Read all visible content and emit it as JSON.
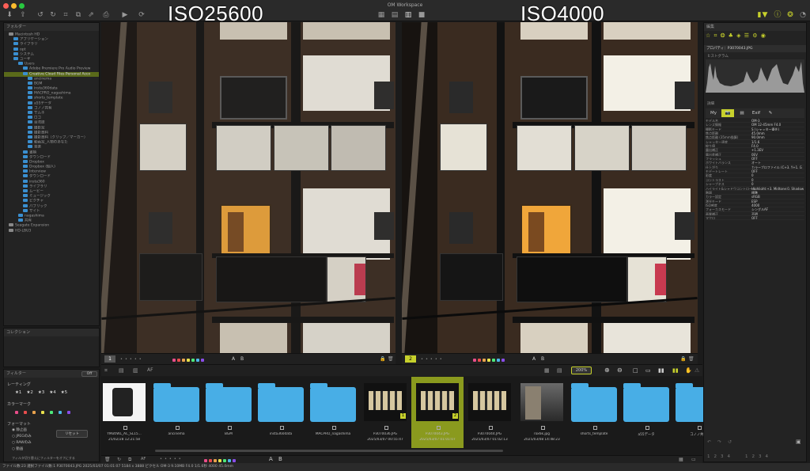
{
  "window": {
    "title": "OM Workspace"
  },
  "overlays": {
    "left": "ISO25600",
    "right": "ISO4000"
  },
  "folder_panel": {
    "title": "フォルダー",
    "tree": [
      {
        "label": "Macintosh HD",
        "indent": 1
      },
      {
        "label": "アプリケーション",
        "indent": 2
      },
      {
        "label": "ライブラリ",
        "indent": 2
      },
      {
        "label": "opt",
        "indent": 2
      },
      {
        "label": "システム",
        "indent": 2
      },
      {
        "label": "ユーザ",
        "indent": 2
      },
      {
        "label": "Users",
        "indent": 3
      },
      {
        "label": "Adobe Premiere Pro Audio Preview",
        "indent": 4
      },
      {
        "label": "Creative Cloud Files Personal Acco",
        "indent": 4,
        "selected": true
      },
      {
        "label": "ancinema",
        "indent": 5
      },
      {
        "label": "BGM",
        "indent": 5
      },
      {
        "label": "insta360data",
        "indent": 5
      },
      {
        "label": "MACPRO_nagashima",
        "indent": 5
      },
      {
        "label": "shorts_template",
        "indent": 5
      },
      {
        "label": "a55データ",
        "indent": 5
      },
      {
        "label": "コノノ共有",
        "indent": 5
      },
      {
        "label": "サムネ",
        "indent": 5
      },
      {
        "label": "ロゴ",
        "indent": 5
      },
      {
        "label": "台湾旅",
        "indent": 5
      },
      {
        "label": "撮影案",
        "indent": 5
      },
      {
        "label": "撮影資料",
        "indent": 5
      },
      {
        "label": "撮影資料（クリップ／マーカー）",
        "indent": 5
      },
      {
        "label": "動画案_人物のあなた",
        "indent": 5
      },
      {
        "label": "音楽",
        "indent": 5
      },
      {
        "label": "書類",
        "indent": 4
      },
      {
        "label": "ダウンロード",
        "indent": 4
      },
      {
        "label": "Dropbox",
        "indent": 4
      },
      {
        "label": "Dropbox (個人)",
        "indent": 4
      },
      {
        "label": "Interview",
        "indent": 4
      },
      {
        "label": "ダウンロード",
        "indent": 4
      },
      {
        "label": "insta360",
        "indent": 4
      },
      {
        "label": "ライブラリ",
        "indent": 4
      },
      {
        "label": "ムービー",
        "indent": 4
      },
      {
        "label": "ミュージック",
        "indent": 4
      },
      {
        "label": "ピクチャ",
        "indent": 4
      },
      {
        "label": "パブリック",
        "indent": 4
      },
      {
        "label": "サイト",
        "indent": 4
      },
      {
        "label": "nagashima",
        "indent": 3
      },
      {
        "label": "共有",
        "indent": 3
      },
      {
        "label": "Seagate Expansion",
        "indent": 1
      },
      {
        "label": "HD-LBU3",
        "indent": 1
      }
    ]
  },
  "collection_panel": {
    "title": "コレクション"
  },
  "filter_panel": {
    "title": "フィルター",
    "toggle": "Off",
    "rating_label": "レーティング",
    "stars": [
      "★1",
      "★2",
      "★3",
      "★4",
      "★5"
    ],
    "color_label": "カラーマーク",
    "format_label": "フォーマット",
    "formats": [
      "静止画",
      "JPEGのみ",
      "RAWのみ",
      "動画"
    ],
    "reset": "リセット",
    "hint": "フィルタ切り替えにフィルターをオフにする"
  },
  "viewer": {
    "left_index": "1",
    "right_index": "2",
    "zoom": "200%",
    "ab_a": "A",
    "ab_b": "B",
    "color_dots": [
      "#e84d8a",
      "#e84d4d",
      "#e8a24d",
      "#e8e04d",
      "#4de87a",
      "#4db6e8",
      "#8a4de8"
    ]
  },
  "filmstrip": {
    "ab_a": "A",
    "ab_b": "B",
    "items": [
      {
        "type": "photo",
        "name": "YMotIWL_AC_SL15...",
        "date": "25/02/28 12:21:58",
        "tone": "light"
      },
      {
        "type": "folder",
        "name": "ancinema"
      },
      {
        "type": "folder",
        "name": "BGM"
      },
      {
        "type": "folder",
        "name": "insta360data"
      },
      {
        "type": "folder",
        "name": "MACPRO_nagashima"
      },
      {
        "type": "photo",
        "name": "P3070036.JPG",
        "date": "2025/03/07 00:55:47",
        "badge": "1",
        "tone": "night"
      },
      {
        "type": "photo",
        "name": "P3070043.JPG",
        "date": "2025/03/07 01:01:07",
        "badge": "2",
        "selected": true,
        "tone": "night"
      },
      {
        "type": "photo",
        "name": "P3070044.JPG",
        "date": "2025/03/07 01:02:13",
        "tone": "night"
      },
      {
        "type": "photo",
        "name": "rox6k.jpg",
        "date": "2025/03/08 14:48:23",
        "tone": "street"
      },
      {
        "type": "folder",
        "name": "shorts_template"
      },
      {
        "type": "folder",
        "name": "a55データ"
      },
      {
        "type": "folder",
        "name": "コノノ共有"
      }
    ]
  },
  "right_panel": {
    "edit_title": "編集",
    "property_title": "プロパティ：P3070043.JPG",
    "histogram_label": "ヒストグラム",
    "detail_label": "詳細",
    "tabs": [
      "My",
      "📷",
      "▤",
      "Exif",
      "✎"
    ],
    "properties": [
      {
        "k": "モデル名",
        "v": "OM-3"
      },
      {
        "k": "レンズ情報",
        "v": "OM 12-45mm F4.0"
      },
      {
        "k": "撮影モード",
        "v": "S (シャッター優先)"
      },
      {
        "k": "焦点距離",
        "v": "45.0mm"
      },
      {
        "k": "焦点距離 (35mm換算)",
        "v": "90.0mm"
      },
      {
        "k": "シャッター速度",
        "v": "1/1.6"
      },
      {
        "k": "絞り値",
        "v": "F4.0"
      },
      {
        "k": "露出補正",
        "v": "+1.3EV"
      },
      {
        "k": "露出差補正",
        "v": "0EV"
      },
      {
        "k": "フラッシュ",
        "v": "OFF"
      },
      {
        "k": "ホワイトバランス",
        "v": "オート"
      },
      {
        "k": "仕上がり",
        "v": "カラープロファイル (C+3, Y+1, G"
      },
      {
        "k": "モデートレート",
        "v": "OFF"
      },
      {
        "k": "彩度",
        "v": "0"
      },
      {
        "k": "コントラスト",
        "v": "0"
      },
      {
        "k": "シャープネス",
        "v": "0"
      },
      {
        "k": "ハイライト&シャドウコントロール",
        "v": "Highlight:+3, Midtone:0, Shadow"
      },
      {
        "k": "階調",
        "v": "標準"
      },
      {
        "k": "カラー設定",
        "v": "sRGB"
      },
      {
        "k": "測光モード",
        "v": "ESP"
      },
      {
        "k": "ISO感度",
        "v": "4000"
      },
      {
        "k": "フォーカスモード",
        "v": "シングルAF"
      },
      {
        "k": "画質補正",
        "v": "不明"
      },
      {
        "k": "マクロ",
        "v": "OFF"
      }
    ],
    "page_numbers": [
      "1",
      "2",
      "3",
      "4",
      "1",
      "2",
      "3",
      "4"
    ]
  },
  "status": {
    "text": "ファイル数:23  選択ファイル数:1  P3070043.JPG  2025/03/07 01:01:07  5184 x 3888 ピクセル  OM-3  9.10MB  F4.0  1/1.6秒  4000  45.0mm"
  }
}
